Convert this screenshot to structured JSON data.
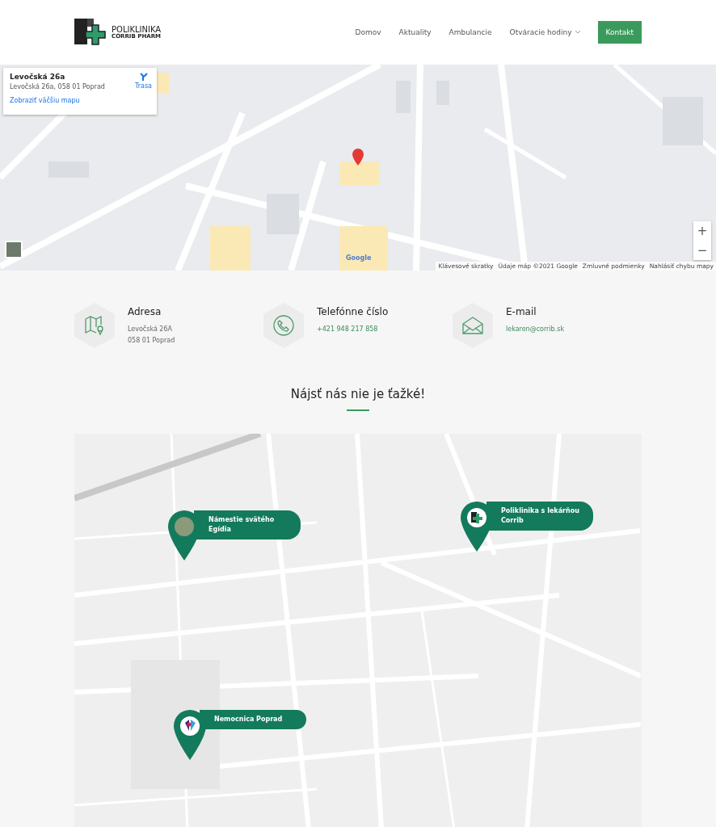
{
  "header": {
    "logo": {
      "line1": "POLIKLINIKA",
      "line2": "CORRIB PHARM"
    },
    "nav": [
      {
        "label": "Domov",
        "kind": "link",
        "dropdown": false
      },
      {
        "label": "Aktuality",
        "kind": "link",
        "dropdown": false
      },
      {
        "label": "Ambulancie",
        "kind": "link",
        "dropdown": false
      },
      {
        "label": "Otváracie hodiny",
        "kind": "link",
        "dropdown": true
      },
      {
        "label": "Kontakt",
        "kind": "button",
        "dropdown": false
      }
    ]
  },
  "map": {
    "card": {
      "title": "Levočská 26a",
      "address": "Levočská 26a, 058 01 Poprad",
      "directions": "Trasa",
      "link": "Zobraziť väčšiu mapu"
    },
    "zoom": [
      "+",
      "−"
    ],
    "brand": "Google",
    "attribution": [
      "Klávesové skratky",
      "Údaje máp ©2021 Google",
      "Zmluvné podmienky",
      "Nahlásiť chybu mapy"
    ]
  },
  "contacts": [
    {
      "kind": "map",
      "title": "Adresa",
      "lines": [
        "Levočská 26A",
        "058 01 Poprad"
      ]
    },
    {
      "kind": "phone",
      "title": "Telefónne číslo",
      "lines": [
        "+421 948 217 858"
      ]
    },
    {
      "kind": "mail",
      "title": "E-mail",
      "lines": [
        "lekaren@corrib.sk"
      ]
    }
  ],
  "section": {
    "title": "Nájsť nás nie je ťažké!"
  },
  "pins": [
    {
      "kind": "photo",
      "label": "Námestie svätého Egídia"
    },
    {
      "kind": "logo",
      "label": "Poliklinika s lekárňou Corrib"
    },
    {
      "kind": "hospital",
      "label": "Nemocnica Poprad"
    }
  ]
}
